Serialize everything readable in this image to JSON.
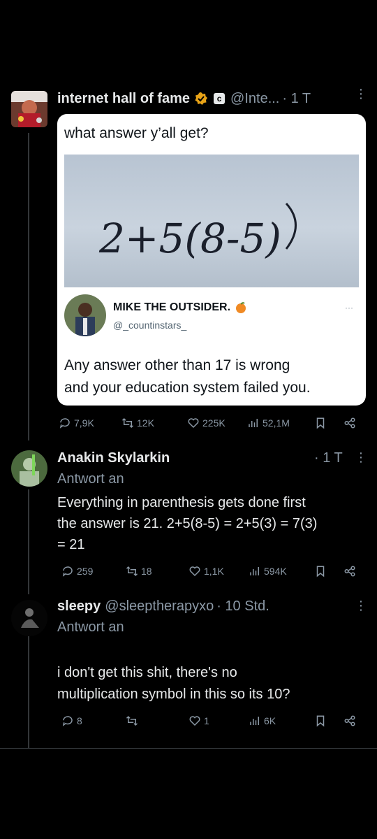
{
  "tweet1": {
    "name": "internet hall of fame",
    "badge_letter": "c",
    "handle": "@Inte...",
    "time": "· 1 T",
    "quote_card": {
      "question": "what answer y’all get?",
      "equation": "2+5(8-5)",
      "author_name": "MIKE THE OUTSIDER.",
      "author_handle": "@_countinstars_",
      "more": "···",
      "text_line1": "Any answer other than 17 is wrong",
      "text_line2": "and your education system failed you."
    },
    "actions": {
      "replies": "7,9K",
      "reposts": "12K",
      "likes": "225K",
      "views": "52,1M"
    }
  },
  "tweet2": {
    "name": "Anakin Skylarkin",
    "time": "· 1 T",
    "reply_label": "Antwort an",
    "text_line1": "Everything in parenthesis gets done first",
    "text_line2": "the answer is 21.  2+5(8-5) = 2+5(3) = 7(3)",
    "text_line3": "= 21",
    "actions": {
      "replies": "259",
      "reposts": "18",
      "likes": "1,1K",
      "views": "594K"
    }
  },
  "tweet3": {
    "name": "sleepy",
    "handle": "@sleeptherapyxo",
    "time": "· 10 Std.",
    "reply_label": "Antwort an",
    "text_line1": "i don't get this shit, there's no",
    "text_line2": "multiplication symbol in this so its 10?",
    "actions": {
      "replies": "8",
      "reposts": "",
      "likes": "1",
      "views": "6K"
    }
  },
  "colors": {
    "background": "#000000",
    "text": "#e7e9ea",
    "muted": "#8b98a5",
    "verified_gold": "#e8a317",
    "card": "#ffffff"
  }
}
